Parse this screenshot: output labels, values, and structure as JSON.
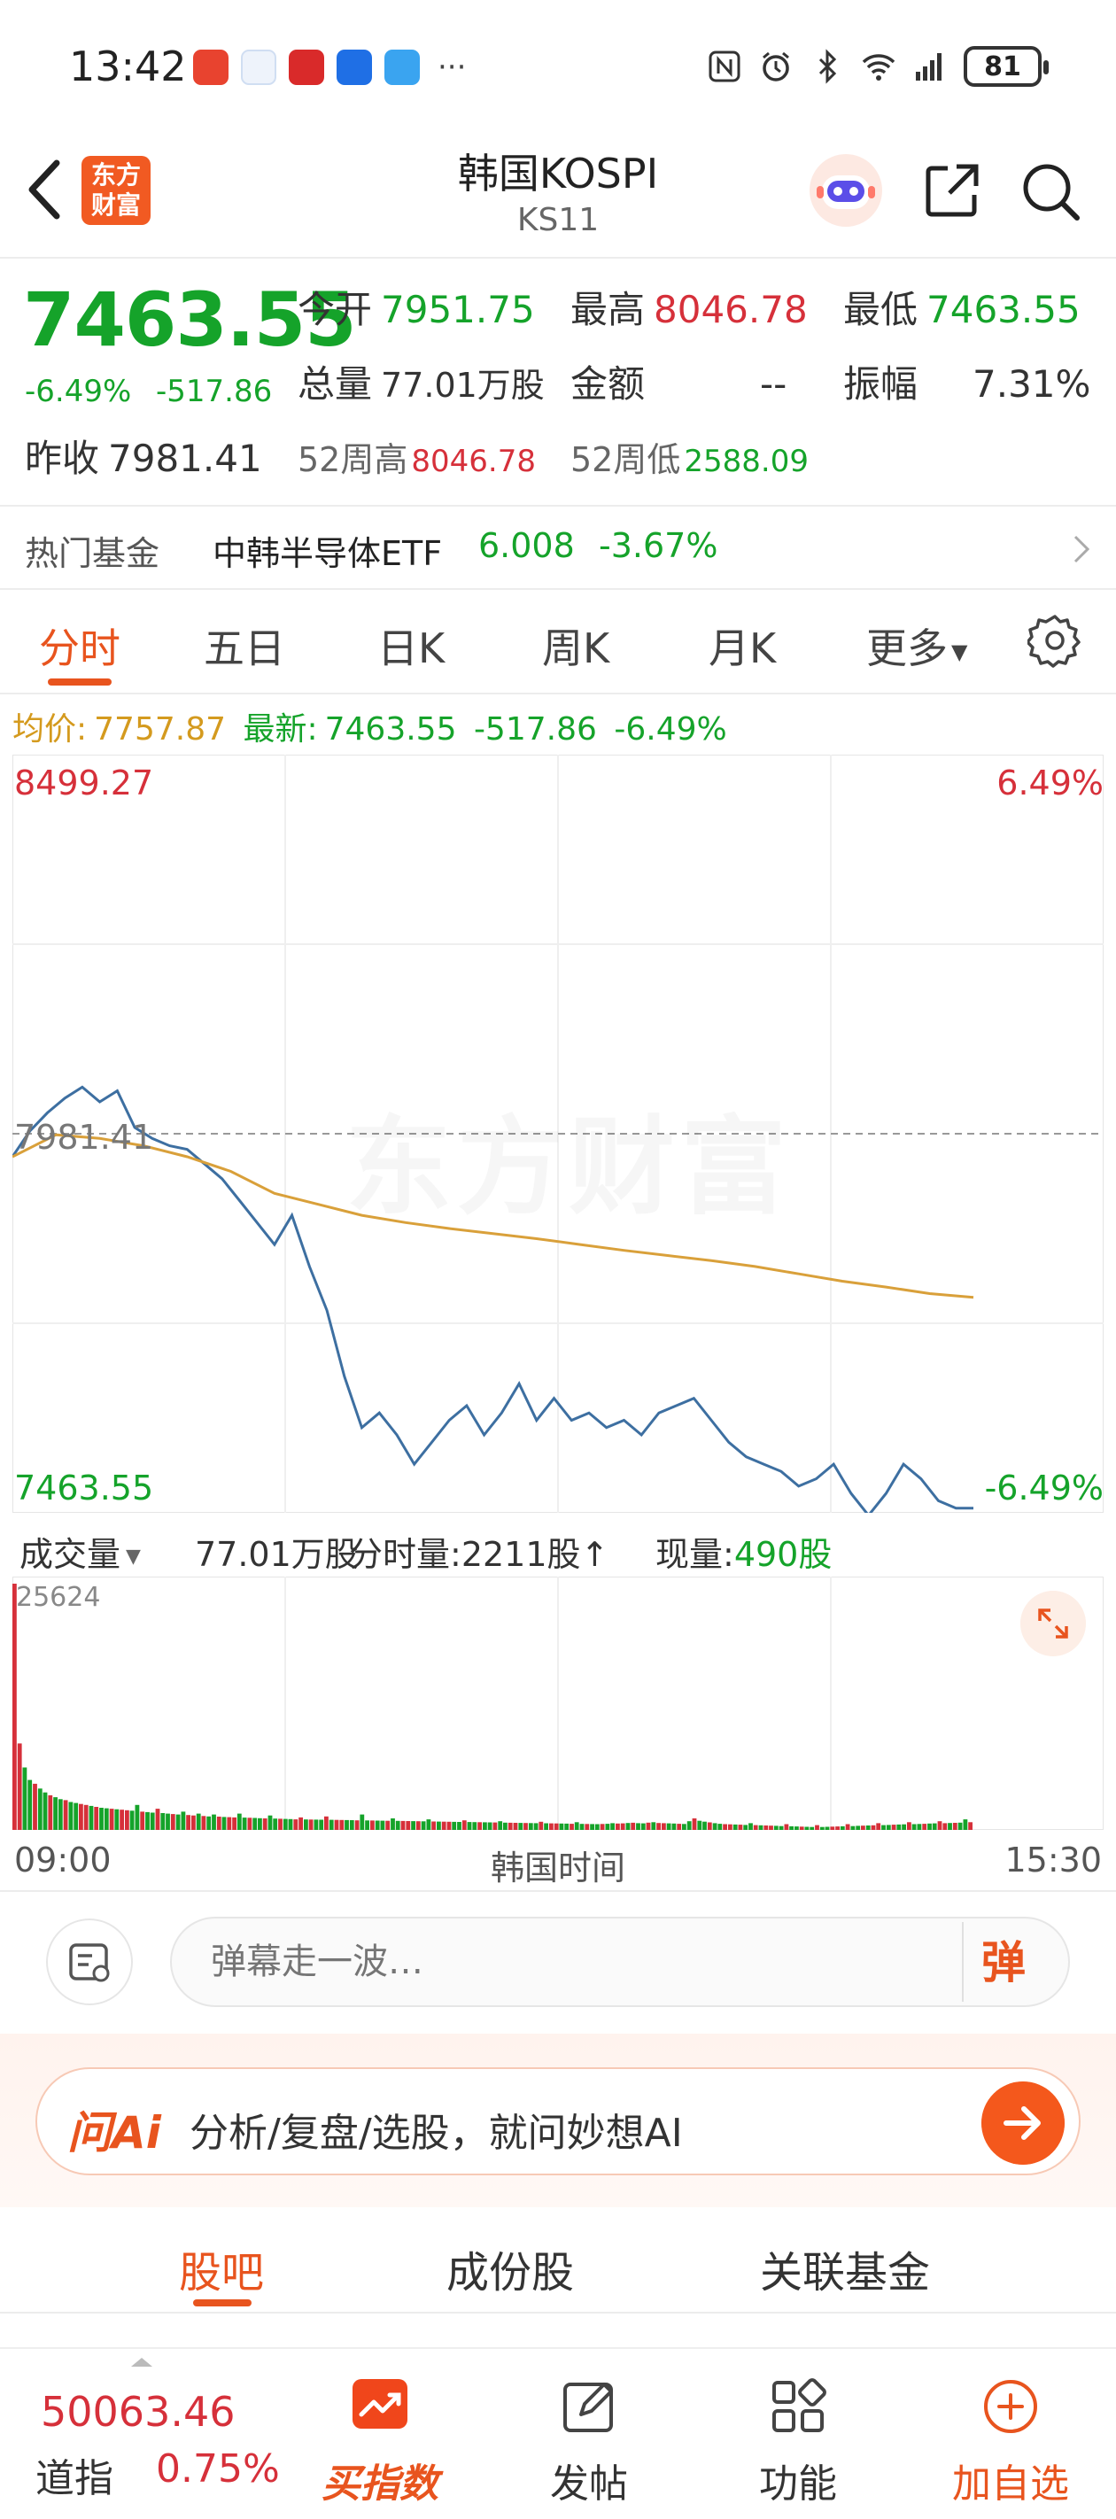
{
  "status_bar": {
    "time": "13:42",
    "more": "···",
    "battery": "81",
    "icons": [
      "nfc-icon",
      "alarm-icon",
      "bluetooth-icon",
      "wifi-icon",
      "signal-icon"
    ]
  },
  "header": {
    "logo_line1": "东方",
    "logo_line2": "财富",
    "title": "韩国KOSPI",
    "code": "KS11"
  },
  "quote": {
    "price": "7463.55",
    "change_pct": "-6.49%",
    "change": "-517.86",
    "open_label": "今开",
    "open": "7951.75",
    "high_label": "最高",
    "high": "8046.78",
    "low_label": "最低",
    "low": "7463.55",
    "volume_label": "总量",
    "volume": "77.01万股",
    "amount_label": "金额",
    "amount": "--",
    "amplitude_label": "振幅",
    "amplitude": "7.31%",
    "prev_close_label": "昨收",
    "prev_close": "7981.41",
    "high52_label": "52周高",
    "high52": "8046.78",
    "low52_label": "52周低",
    "low52": "2588.09"
  },
  "fund": {
    "label": "热门基金",
    "name": "中韩半导体ETF",
    "price": "6.008",
    "pct": "-3.67%"
  },
  "chart_tabs": [
    "分时",
    "五日",
    "日K",
    "周K",
    "月K",
    "更多"
  ],
  "avg_line": {
    "avg_label": "均价:",
    "avg_value": "7757.87",
    "latest_label": "最新:",
    "latest_value": "7463.55",
    "latest_change": "-517.86",
    "latest_pct": "-6.49%"
  },
  "chart_labels": {
    "y_max": "8499.27",
    "y_max_pct": "6.49%",
    "y_ref": "7981.41",
    "y_min": "7463.55",
    "y_min_pct": "-6.49%",
    "watermark": "东方财富"
  },
  "volume_row": {
    "dropdown_label": "成交量",
    "total": "77.01万股",
    "tick_label": "分时量:",
    "tick_value": "2211股↑",
    "now_label": "现量:",
    "now_value": "490股",
    "vol_max": "25624"
  },
  "time_axis": {
    "start": "09:00",
    "label": "韩国时间",
    "end": "15:30"
  },
  "danmu": {
    "placeholder": "弹幕走一波…",
    "send": "弹"
  },
  "ai": {
    "logo": "问Ai",
    "text": "分析/复盘/选股，就问妙想AI"
  },
  "community_tabs": [
    "股吧",
    "成份股",
    "关联基金"
  ],
  "bottom_nav": {
    "dow_price": "50063.46",
    "dow_name": "道指",
    "dow_pct": "0.75%",
    "items": [
      "买指数",
      "发帖",
      "功能",
      "加自选"
    ]
  },
  "colors": {
    "up": "#d6303a",
    "down": "#15a32a",
    "accent": "#e8541e",
    "price_line": "#3d6fa1",
    "avg_line": "#d9a03a"
  },
  "chart_data": {
    "type": "line",
    "x_range": [
      "09:00",
      "15:30"
    ],
    "ylim": [
      7463.55,
      8499.27
    ],
    "reference": 7981.41,
    "series": [
      {
        "values": [
          7950,
          7985,
          8010,
          8030,
          8045,
          8025,
          8040,
          7990,
          7975,
          7965,
          7960,
          7940,
          7920,
          7890,
          7860,
          7830,
          7870,
          7800,
          7740,
          7650,
          7580,
          7600,
          7570,
          7530,
          7560,
          7590,
          7610,
          7570,
          7600,
          7640,
          7590,
          7620,
          7590,
          7600,
          7580,
          7590,
          7570,
          7600,
          7610,
          7620,
          7590,
          7560,
          7540,
          7530,
          7520,
          7500,
          7510,
          7530,
          7490,
          7460,
          7490,
          7530,
          7510,
          7480,
          7470,
          7470
        ]
      },
      {
        "values": [
          7950,
          7980,
          7975,
          7965,
          7950,
          7930,
          7900,
          7885,
          7870,
          7860,
          7852,
          7845,
          7838,
          7830,
          7822,
          7815,
          7808,
          7800,
          7790,
          7780,
          7772,
          7763,
          7757.87
        ]
      }
    ]
  },
  "volume_data": {
    "type": "bar",
    "max": 25624,
    "values": [
      25624,
      9000,
      6500,
      5200,
      4800,
      4300,
      3900,
      3600,
      3400,
      3200,
      3100,
      2900,
      2800,
      2700,
      2600,
      2500,
      2400,
      2300,
      2250,
      2200,
      2150,
      2100,
      2050,
      2000,
      2600,
      1900,
      1850,
      1800,
      2200,
      1750,
      1700,
      1650,
      1600,
      1900,
      1550,
      1500,
      1700,
      1450,
      1400,
      1600,
      1380,
      1350,
      1330,
      1300,
      1700,
      1280,
      1260,
      1240,
      1220,
      1200,
      1500,
      1180,
      1160,
      1140,
      1120,
      1100,
      1300,
      1090,
      1080,
      1070,
      1060,
      1400,
      1050,
      1040,
      1030,
      1020,
      1010,
      1000,
      1600,
      990,
      980,
      970,
      960,
      950,
      1200,
      940,
      930,
      920,
      910,
      900,
      890,
      1100,
      880,
      870,
      860,
      850,
      840,
      830,
      1000,
      820,
      810,
      800,
      790,
      780,
      770,
      900,
      760,
      750,
      740,
      730,
      720,
      710,
      700,
      850,
      690,
      680,
      670,
      660,
      650,
      640,
      800,
      630,
      620,
      610,
      600,
      620,
      640,
      700,
      660,
      680,
      720,
      750,
      700,
      680,
      760,
      800,
      720,
      700,
      680,
      660,
      640,
      620,
      900,
      1200,
      950,
      860,
      780,
      700,
      640,
      600,
      580,
      560,
      540,
      520,
      700,
      500,
      480,
      460,
      440,
      420,
      400,
      600,
      380,
      360,
      340,
      320,
      300,
      500,
      300,
      320,
      340,
      360,
      380,
      600,
      400,
      420,
      440,
      460,
      480,
      700,
      500,
      520,
      540,
      560,
      580,
      800,
      600,
      620,
      640,
      660,
      680,
      900,
      700,
      720,
      740,
      760,
      1100,
      800
    ]
  }
}
